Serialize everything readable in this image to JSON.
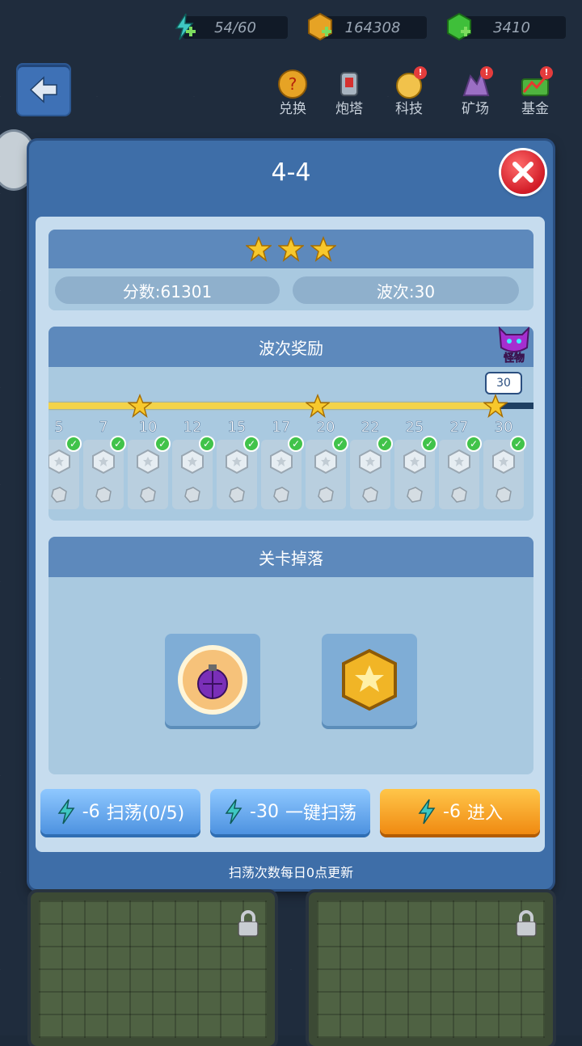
{
  "resources": [
    {
      "icon": "energy-bolt-icon",
      "value": "54/60",
      "color": "#3ec7c2"
    },
    {
      "icon": "gold-coin-icon",
      "value": "164308",
      "color": "#e6a325"
    },
    {
      "icon": "green-gem-icon",
      "value": "3410",
      "color": "#3fbf3a"
    }
  ],
  "menu": [
    {
      "icon": "exchange-icon",
      "label": "兑换",
      "badge": ""
    },
    {
      "icon": "turret-icon",
      "label": "炮塔",
      "badge": ""
    },
    {
      "icon": "technology-icon",
      "label": "科技",
      "badge": "!"
    },
    {
      "icon": "mine-icon",
      "label": "矿场",
      "badge": "!"
    },
    {
      "icon": "fund-icon",
      "label": "基金",
      "badge": "!"
    }
  ],
  "dialog": {
    "title": "4-4",
    "stars": 3,
    "score_text": "分数:61301",
    "wave_text": "波次:30",
    "wave_reward_title": "波次奖励",
    "monster_label": "怪物",
    "current_wave_bubble": "30",
    "progress_fraction": 1.0,
    "wave_columns": [
      "5",
      "7",
      "10",
      "12",
      "15",
      "17",
      "20",
      "22",
      "25",
      "27",
      "30"
    ],
    "star_waves": [
      "10",
      "20",
      "30"
    ],
    "drop_title": "关卡掉落",
    "drops": [
      {
        "icon": "grenade-icon"
      },
      {
        "icon": "gold-coin-icon"
      }
    ],
    "buttons": [
      {
        "cost": "-6",
        "label": "扫荡(0/5)",
        "style": "blue"
      },
      {
        "cost": "-30",
        "label": "一键扫荡",
        "style": "blue"
      },
      {
        "cost": "-6",
        "label": "进入",
        "style": "orange"
      }
    ],
    "footer_note": "扫荡次数每日0点更新"
  }
}
